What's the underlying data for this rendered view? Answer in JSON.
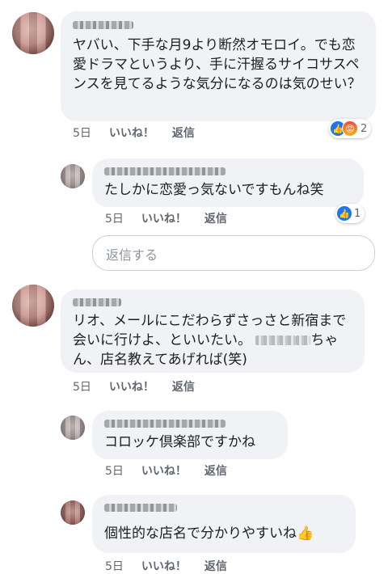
{
  "comments": [
    {
      "text": "ヤバい、下手な月9より断然オモロイ。でも恋愛ドラマというより、手に汗握るサイコサスペンスを見てるような気分になるのは気のせい？",
      "time": "5日",
      "like": "いいね！",
      "reply": "返信",
      "reaction_count": "2"
    },
    {
      "text": "たしかに恋愛っ気ないですもんね笑",
      "time": "5日",
      "like": "いいね！",
      "reply": "返信",
      "reaction_count": "1"
    },
    {
      "text_a": "リオ、メールにこだわらずさっさと新宿まで会いに行けよ、といいたい。",
      "text_b": "ちゃん、店名教えてあげれば(笑)",
      "time": "5日",
      "like": "いいね！",
      "reply": "返信"
    },
    {
      "text": "コロッケ倶楽部ですかね",
      "time": "5日",
      "like": "いいね！",
      "reply": "返信"
    },
    {
      "text": "個性的な店名で分かりやすいね👍",
      "time": "5日",
      "like": "いいね！",
      "reply": "返信"
    }
  ],
  "reply_box": {
    "placeholder": "返信する"
  },
  "icons": {
    "like": "thumbs-up-icon",
    "angry": "angry-face-icon"
  },
  "colors": {
    "bubble": "#f0f2f5",
    "like_blue": "#1877f2",
    "meta": "#606770"
  }
}
